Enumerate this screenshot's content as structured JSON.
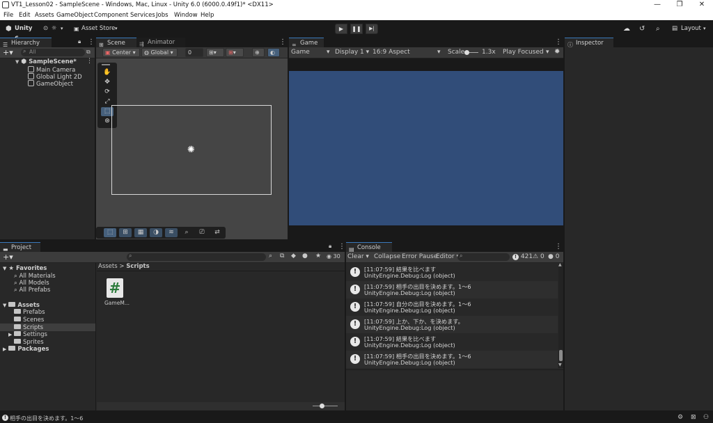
{
  "window": {
    "title": "VT1_Lesson02 - SampleScene - Windows, Mac, Linux - Unity 6.0 (6000.0.49f1)* <DX11>",
    "controls": {
      "minimize": "—",
      "maximize": "❐",
      "close": "✕"
    }
  },
  "menu": [
    "File",
    "Edit",
    "Assets",
    "GameObject",
    "Component",
    "Services",
    "Jobs",
    "Window",
    "Help"
  ],
  "toolbar": {
    "unity_label": "Unity 6",
    "account_glyph": "⊙",
    "cloud_glyph": "☼",
    "asset_store_label": "Asset Store",
    "play": "▶",
    "pause": "❚❚",
    "step": "▶|",
    "layout_label": "Layout"
  },
  "hierarchy": {
    "tab_label": "Hierarchy",
    "search_placeholder": "All",
    "scene_name": "SampleScene*",
    "items": [
      "Main Camera",
      "Global Light 2D",
      "GameObject"
    ]
  },
  "scene": {
    "tab_label": "Scene",
    "animator_tab_label": "Animator",
    "pivot_label": "Center",
    "space_label": "Global",
    "snap_value": "0"
  },
  "game": {
    "tab_label": "Game",
    "mode_label": "Game",
    "display_label": "Display 1",
    "aspect_label": "16:9 Aspect",
    "scale_label": "Scale",
    "scale_value": "1.3x",
    "play_focus_label": "Play Focused",
    "viewport_color": "#314d79"
  },
  "inspector": {
    "tab_label": "Inspector"
  },
  "project": {
    "tab_label": "Project",
    "item_count": "30",
    "favorites_label": "Favorites",
    "favorites": [
      "All Materials",
      "All Models",
      "All Prefabs"
    ],
    "assets_label": "Assets",
    "asset_folders": [
      "Prefabs",
      "Scenes",
      "Scripts",
      "Settings",
      "Sprites"
    ],
    "packages_label": "Packages",
    "breadcrumb_root": "Assets",
    "breadcrumb_sep": ">",
    "breadcrumb_current": "Scripts",
    "files": [
      {
        "name": "GameM...",
        "icon": "#"
      }
    ]
  },
  "console": {
    "tab_label": "Console",
    "clear_label": "Clear",
    "collapse_label": "Collapse",
    "error_pause_label": "Error Pause",
    "editor_label": "Editor",
    "log_count": "421",
    "warn_count": "0",
    "error_count": "0",
    "entries": [
      {
        "line1": "[11:07:59] 結果を比べます",
        "line2": "UnityEngine.Debug:Log (object)"
      },
      {
        "line1": "[11:07:59] 相手の出目を決めます。1～6",
        "line2": "UnityEngine.Debug:Log (object)"
      },
      {
        "line1": "[11:07:59] 自分の出目を決めます。1～6",
        "line2": "UnityEngine.Debug:Log (object)"
      },
      {
        "line1": "[11:07:59] 上か、下か、を決めます。",
        "line2": "UnityEngine.Debug:Log (object)"
      },
      {
        "line1": "[11:07:59] 結果を比べます",
        "line2": "UnityEngine.Debug:Log (object)"
      },
      {
        "line1": "[11:07:59] 相手の出目を決めます。1～6",
        "line2": "UnityEngine.Debug:Log (object)"
      }
    ]
  },
  "statusbar": {
    "message": "相手の出目を決めます。1～6"
  }
}
